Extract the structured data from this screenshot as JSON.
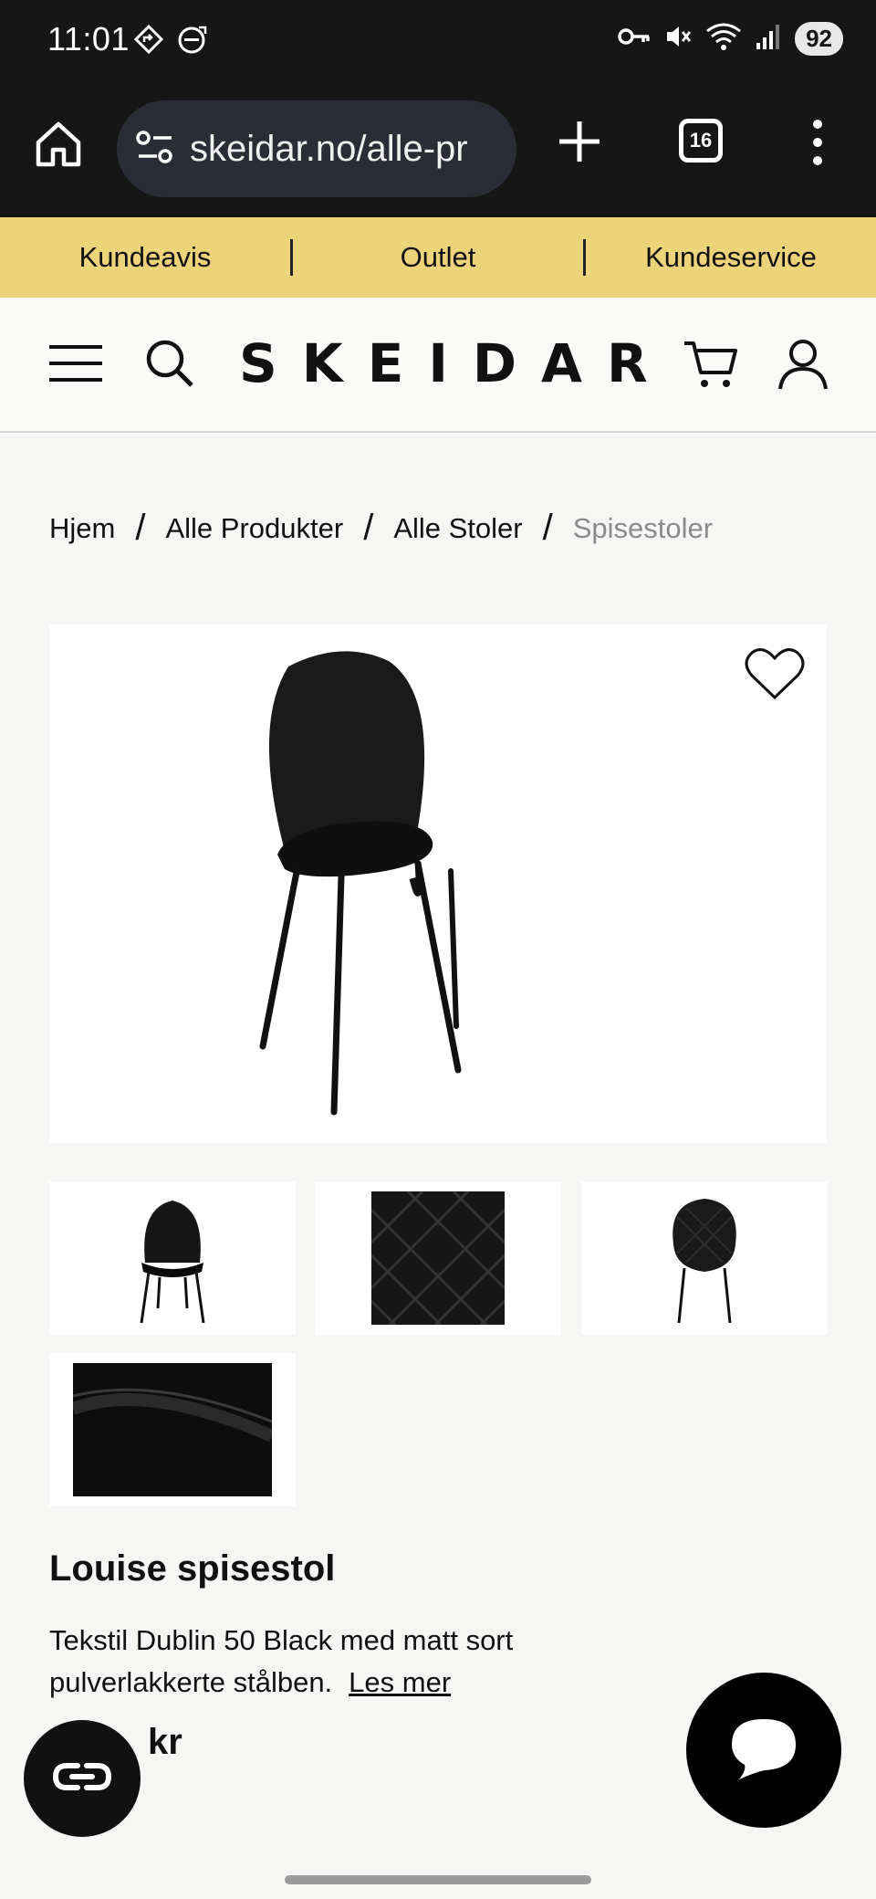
{
  "status_bar": {
    "time": "11:01",
    "battery": "92",
    "icons": [
      "navigation-icon",
      "volvo-icon",
      "key-icon",
      "mute-icon",
      "wifi-icon",
      "signal-icon"
    ]
  },
  "browser": {
    "url": "skeidar.no/alle-pr",
    "tab_count": "16",
    "icons": [
      "home-icon",
      "site-settings-icon",
      "plus-icon",
      "more-icon"
    ]
  },
  "top_nav": {
    "items": [
      "Kundeavis",
      "Outlet",
      "Kundeservice"
    ],
    "background": "#edd37a"
  },
  "header": {
    "logo": "SKEIDAR",
    "icons": [
      "menu-icon",
      "search-icon",
      "cart-icon",
      "user-icon"
    ]
  },
  "breadcrumb": {
    "items": [
      "Hjem",
      "Alle Produkter",
      "Alle Stoler",
      "Spisestoler"
    ],
    "separator": "/"
  },
  "product": {
    "title": "Louise spisestol",
    "description": "Tekstil Dublin 50 Black med matt sort pulverlakkerte stålben.",
    "read_more": "Les mer",
    "price_visible": "kr",
    "thumbnails": [
      "chair-front",
      "fabric-quilted-detail",
      "chair-back",
      "fabric-velvet"
    ]
  },
  "colors": {
    "status_bg": "#161616",
    "accent_yellow": "#edd37a",
    "page_bg": "#f6f6f4",
    "muted_text": "#8a8a8a"
  }
}
